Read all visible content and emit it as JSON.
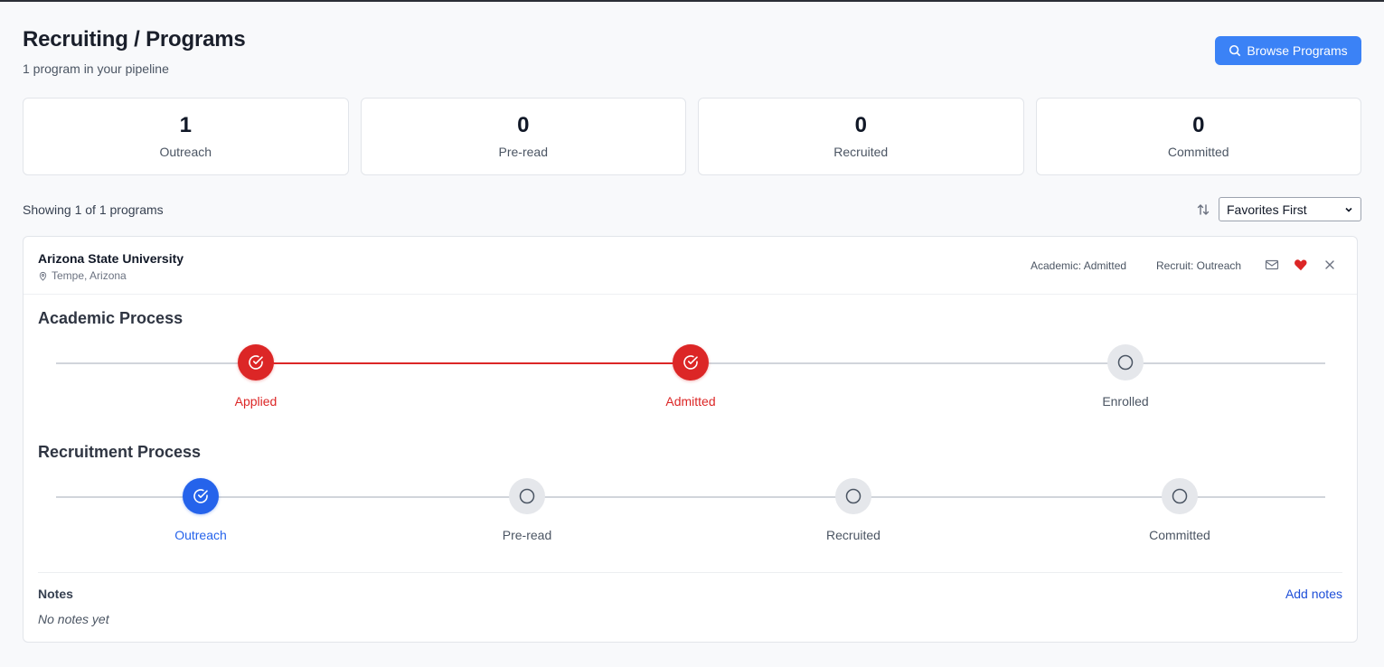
{
  "header": {
    "title": "Recruiting / Programs",
    "subtitle": "1 program in your pipeline",
    "browse_label": "Browse Programs"
  },
  "stats": [
    {
      "value": "1",
      "label": "Outreach"
    },
    {
      "value": "0",
      "label": "Pre-read"
    },
    {
      "value": "0",
      "label": "Recruited"
    },
    {
      "value": "0",
      "label": "Committed"
    }
  ],
  "toolbar": {
    "showing": "Showing 1 of 1 programs",
    "sort_selected": "Favorites First"
  },
  "program": {
    "name": "Arizona State University",
    "location": "Tempe, Arizona",
    "academic_status": "Academic: Admitted",
    "recruit_status": "Recruit: Outreach",
    "favorite": true
  },
  "academic": {
    "title": "Academic Process",
    "steps": [
      {
        "label": "Applied",
        "state": "complete"
      },
      {
        "label": "Admitted",
        "state": "complete"
      },
      {
        "label": "Enrolled",
        "state": "pending"
      }
    ]
  },
  "recruitment": {
    "title": "Recruitment Process",
    "steps": [
      {
        "label": "Outreach",
        "state": "complete"
      },
      {
        "label": "Pre-read",
        "state": "pending"
      },
      {
        "label": "Recruited",
        "state": "pending"
      },
      {
        "label": "Committed",
        "state": "pending"
      }
    ]
  },
  "notes": {
    "title": "Notes",
    "add_label": "Add notes",
    "empty_text": "No notes yet"
  },
  "colors": {
    "primary": "#3b82f6",
    "academic_accent": "#dc2626",
    "recruit_accent": "#2563eb",
    "pending": "#e5e7eb"
  }
}
